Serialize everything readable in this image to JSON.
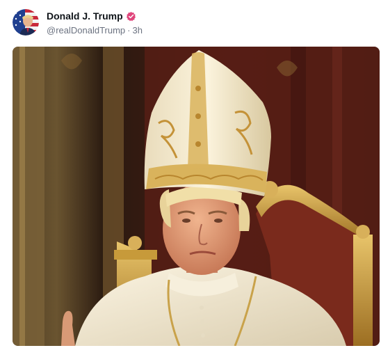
{
  "post": {
    "author": {
      "display_name": "Donald J. Trump",
      "handle": "@realDonaldTrump",
      "separator": "·",
      "time_ago": "3h",
      "verified": true,
      "verified_badge_color": "#e0457b",
      "avatar_icon": "american-flag-portrait-avatar"
    },
    "media": {
      "type": "image",
      "icon": "pope-portrait-image",
      "colors": {
        "background": "#3a2414",
        "curtain": "#5b1f16",
        "gold": "#c79a3a",
        "robe": "#efe6cf"
      }
    }
  }
}
